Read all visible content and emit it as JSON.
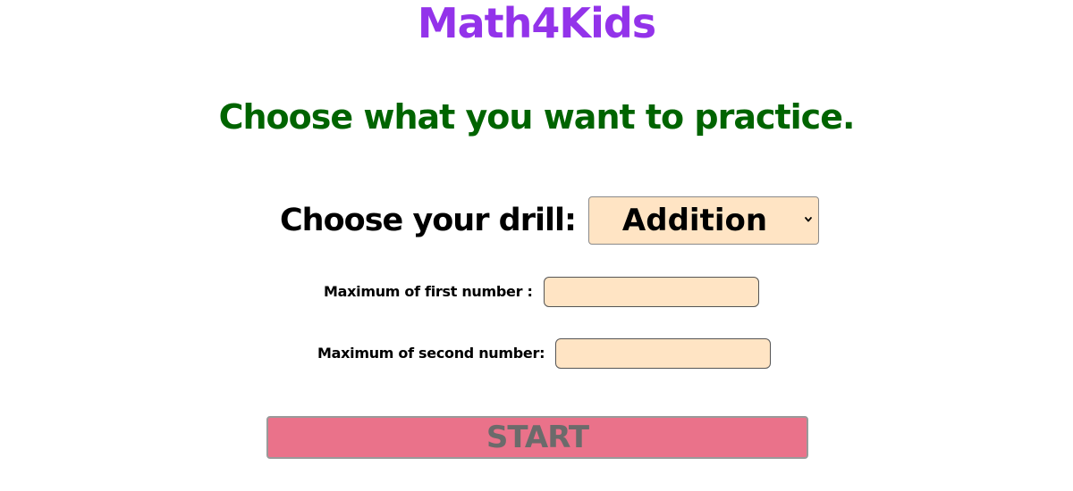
{
  "header": {
    "title": "Math4Kids",
    "subtitle": "Choose what you want to practice."
  },
  "drill": {
    "label": "Choose your drill:",
    "selected": "Addition",
    "icon": "chevron-down-icon"
  },
  "fields": {
    "first": {
      "label": "Maximum of first number :",
      "value": ""
    },
    "second": {
      "label": "Maximum of second number:",
      "value": ""
    }
  },
  "start_button": {
    "label": "START"
  },
  "colors": {
    "title": "#9333ea",
    "subtitle": "#006400",
    "input_bg": "#ffe4c4",
    "button_bg": "#ea728a",
    "button_text": "#6b6b6b"
  }
}
